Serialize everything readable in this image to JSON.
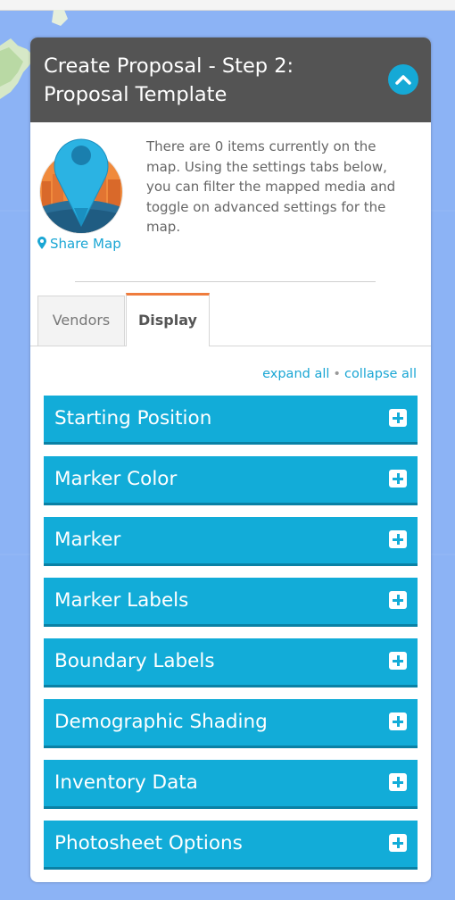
{
  "panel": {
    "title": "Create Proposal - Step 2: Proposal Template"
  },
  "intro": {
    "share_label": "Share Map",
    "description": "There are 0 items currently on the map. Using the settings tabs below, you can filter the mapped media and toggle on advanced settings for the map."
  },
  "tabs": [
    {
      "label": "Vendors",
      "active": false
    },
    {
      "label": "Display",
      "active": true
    }
  ],
  "controls": {
    "expand_all": "expand all",
    "separator": "•",
    "collapse_all": "collapse all"
  },
  "sections": [
    {
      "label": "Starting Position"
    },
    {
      "label": "Marker Color"
    },
    {
      "label": "Marker"
    },
    {
      "label": "Marker Labels"
    },
    {
      "label": "Boundary Labels"
    },
    {
      "label": "Demographic Shading"
    },
    {
      "label": "Inventory Data"
    },
    {
      "label": "Photosheet Options"
    }
  ],
  "icons": {
    "collapse": "chevron-up-icon",
    "share": "map-marker-icon",
    "section_toggle": "plus-square-icon",
    "logo": "map-pin-logo"
  },
  "colors": {
    "header_bg": "#545454",
    "accent_blue": "#12acd8",
    "tab_active_border": "#ef7c3d",
    "map_water": "#8cb3f5"
  }
}
